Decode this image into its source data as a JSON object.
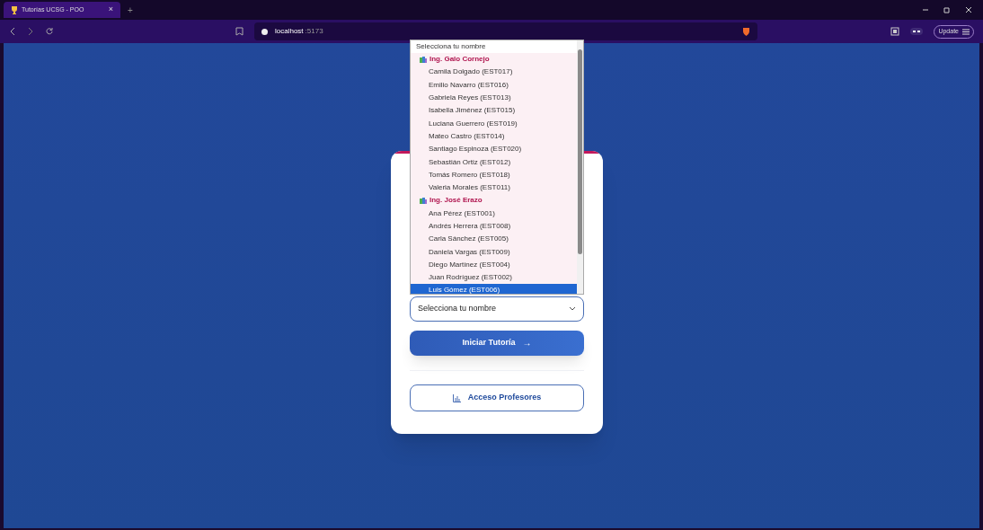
{
  "browser": {
    "tab_title": "Tutorías UCSG - POO",
    "tab_close": "×",
    "new_tab": "+",
    "url_host": "localhost",
    "url_port": ":5173",
    "update_label": "Update"
  },
  "dropdown": {
    "placeholder_option": "Selecciona tu nombre",
    "groups": [
      {
        "label": "Ing. Galo Cornejo",
        "options": [
          {
            "label": "Camila Dolgado (EST017)",
            "selected": false
          },
          {
            "label": "Emilio Navarro (EST016)",
            "selected": false
          },
          {
            "label": "Gabriela Reyes (EST013)",
            "selected": false
          },
          {
            "label": "Isabella Jiménez (EST015)",
            "selected": false
          },
          {
            "label": "Luciana Guerrero (EST019)",
            "selected": false
          },
          {
            "label": "Mateo Castro (EST014)",
            "selected": false
          },
          {
            "label": "Santiago Espinoza (EST020)",
            "selected": false
          },
          {
            "label": "Sebastián Ortiz (EST012)",
            "selected": false
          },
          {
            "label": "Tomás Romero (EST018)",
            "selected": false
          },
          {
            "label": "Valeria Morales (EST011)",
            "selected": false
          }
        ]
      },
      {
        "label": "Ing. José Erazo",
        "options": [
          {
            "label": "Ana Pérez (EST001)",
            "selected": false
          },
          {
            "label": "Andrés Herrera (EST008)",
            "selected": false
          },
          {
            "label": "Carla Sánchez (EST005)",
            "selected": false
          },
          {
            "label": "Daniela Vargas (EST009)",
            "selected": false
          },
          {
            "label": "Diego Martínez (EST004)",
            "selected": false
          },
          {
            "label": "Juan Rodríguez (EST002)",
            "selected": false
          },
          {
            "label": "Luis Gómez (EST006)",
            "selected": true
          }
        ]
      }
    ]
  },
  "select": {
    "value": "Selecciona tu nombre"
  },
  "start_button": {
    "label": "Iniciar Tutoría",
    "arrow": "→"
  },
  "teacher_button": {
    "label": "Acceso Profesores"
  }
}
